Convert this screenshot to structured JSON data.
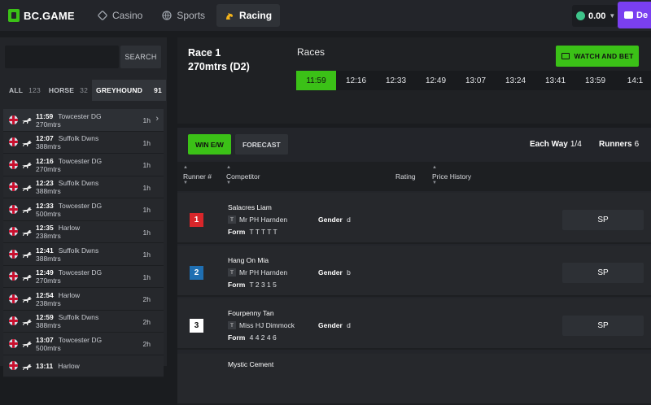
{
  "header": {
    "logo": "BC.GAME",
    "nav": [
      {
        "label": "Casino",
        "icon": "casino-icon"
      },
      {
        "label": "Sports",
        "icon": "sports-icon"
      },
      {
        "label": "Racing",
        "icon": "horse-icon",
        "active": true
      }
    ],
    "balance": "0.00",
    "deposit_label": "De"
  },
  "sidebar": {
    "search_placeholder": "",
    "search_button": "SEARCH",
    "filters": [
      {
        "label": "ALL",
        "count": "123"
      },
      {
        "label": "HORSE",
        "count": "32"
      },
      {
        "label": "GREYHOUND",
        "count": "91",
        "active": true
      }
    ],
    "races": [
      {
        "time": "11:59",
        "venue": "Towcester DG",
        "distance": "270mtrs",
        "eta": "1h",
        "active": true
      },
      {
        "time": "12:07",
        "venue": "Suffolk Dwns",
        "distance": "388mtrs",
        "eta": "1h"
      },
      {
        "time": "12:16",
        "venue": "Towcester DG",
        "distance": "270mtrs",
        "eta": "1h"
      },
      {
        "time": "12:23",
        "venue": "Suffolk Dwns",
        "distance": "388mtrs",
        "eta": "1h"
      },
      {
        "time": "12:33",
        "venue": "Towcester DG",
        "distance": "500mtrs",
        "eta": "1h"
      },
      {
        "time": "12:35",
        "venue": "Harlow",
        "distance": "238mtrs",
        "eta": "1h"
      },
      {
        "time": "12:41",
        "venue": "Suffolk Dwns",
        "distance": "388mtrs",
        "eta": "1h"
      },
      {
        "time": "12:49",
        "venue": "Towcester DG",
        "distance": "270mtrs",
        "eta": "1h"
      },
      {
        "time": "12:54",
        "venue": "Harlow",
        "distance": "238mtrs",
        "eta": "2h"
      },
      {
        "time": "12:59",
        "venue": "Suffolk Dwns",
        "distance": "388mtrs",
        "eta": "2h"
      },
      {
        "time": "13:07",
        "venue": "Towcester DG",
        "distance": "500mtrs",
        "eta": "2h"
      },
      {
        "time": "13:11",
        "venue": "Harlow",
        "distance": "",
        "eta": ""
      }
    ]
  },
  "race_header": {
    "title_line1": "Race 1",
    "title_line2": "270mtrs (D2)",
    "races_label": "Races",
    "watch_label": "WATCH AND BET",
    "times": [
      "11:59",
      "12:16",
      "12:33",
      "12:49",
      "13:07",
      "13:24",
      "13:41",
      "13:59",
      "14:1"
    ]
  },
  "main": {
    "tabs": [
      {
        "label": "WIN E/W",
        "active": true
      },
      {
        "label": "FORECAST"
      }
    ],
    "each_way_label": "Each Way",
    "each_way_value": "1/4",
    "runners_label": "Runners",
    "runners_value": "6",
    "columns": [
      "Runner #",
      "Competitor",
      "Rating",
      "Price History"
    ],
    "gender_label": "Gender",
    "form_label": "Form",
    "trainer_badge": "T",
    "runners": [
      {
        "number": "1",
        "name": "Salacres Liam",
        "trainer": "Mr PH Harnden",
        "gender": "d",
        "form": "T T T T T",
        "price": "SP",
        "color": "#d8262a",
        "text_color": "#ffffff"
      },
      {
        "number": "2",
        "name": "Hang On Mia",
        "trainer": "Mr PH Harnden",
        "gender": "b",
        "form": "T 2 3 1 5",
        "price": "SP",
        "color": "#1f6fb2",
        "text_color": "#ffffff"
      },
      {
        "number": "3",
        "name": "Fourpenny Tan",
        "trainer": "Miss HJ Dimmock",
        "gender": "d",
        "form": "4 4 2 4 6",
        "price": "SP",
        "color": "#ffffff",
        "text_color": "#111111"
      }
    ],
    "next_partial": "Mystic Cement"
  }
}
